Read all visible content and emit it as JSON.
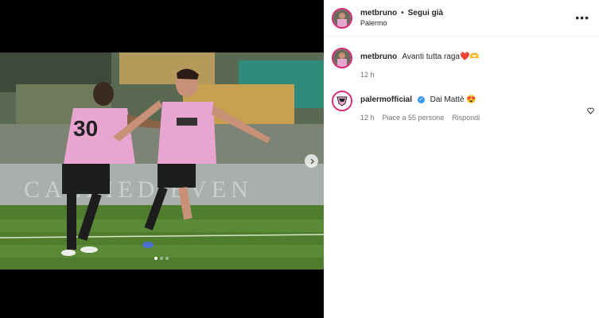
{
  "post": {
    "username": "metbruno",
    "separator": "•",
    "follow_label": "Segui già",
    "location": "Palermo",
    "more_label": "•••",
    "carousel": {
      "slide_count": 3,
      "active_index": 0
    }
  },
  "caption": {
    "username": "metbruno",
    "text": "Avanti tutta raga❤️🫶",
    "time": "12 h"
  },
  "comments": [
    {
      "username": "palermofficial",
      "verified": true,
      "text": "Dai Mattè 😍",
      "time": "12 h",
      "likes": "Piace a 55 persone",
      "reply_label": "Rispondi"
    }
  ],
  "colors": {
    "jersey": "#e8a5cf",
    "pitch": "#4f7d2d",
    "verified": "#3897f0"
  },
  "icons": {
    "verified": "verified-badge-icon",
    "like": "heart-icon",
    "next": "chevron-right-icon"
  }
}
